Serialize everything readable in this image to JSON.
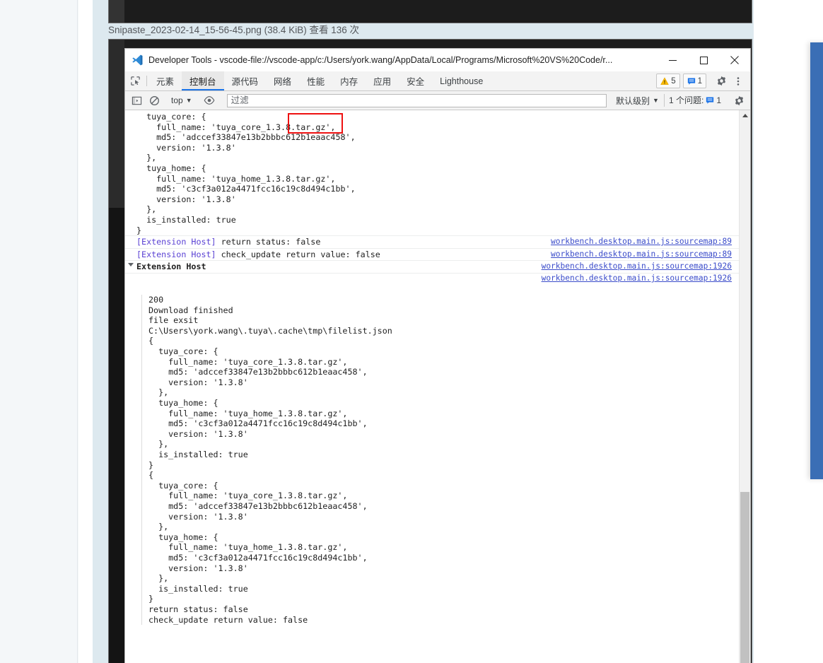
{
  "attachment": {
    "caption": "Snipaste_2023-02-14_15-56-45.png (38.4 KiB) 查看 136 次"
  },
  "devtools": {
    "window_title": "Developer Tools - vscode-file://vscode-app/c:/Users/york.wang/AppData/Local/Programs/Microsoft%20VS%20Code/r...",
    "window_controls": {
      "minimize": "minimize-icon",
      "maximize": "maximize-icon",
      "close": "close-icon"
    },
    "logo_icon": "vscode-logo-icon",
    "inspect_icon": "inspect-element-icon",
    "tabs": [
      {
        "label": "元素",
        "active": false
      },
      {
        "label": "控制台",
        "active": true
      },
      {
        "label": "源代码",
        "active": false
      },
      {
        "label": "网络",
        "active": false
      },
      {
        "label": "性能",
        "active": false
      },
      {
        "label": "内存",
        "active": false
      },
      {
        "label": "应用",
        "active": false
      },
      {
        "label": "安全",
        "active": false
      },
      {
        "label": "Lighthouse",
        "active": false
      }
    ],
    "badges": {
      "warning_icon": "warning-triangle-icon",
      "warning_count": "5",
      "info_icon": "info-message-icon",
      "info_count": "1"
    },
    "settings_icon": "gear-icon",
    "more_icon": "kebab-menu-icon",
    "accent_color": "#1a73e8",
    "annotation_color": "#ee1111"
  },
  "console_toolbar": {
    "sidebar_toggle_icon": "console-sidebar-toggle-icon",
    "clear_icon": "clear-console-icon",
    "context_label": "top",
    "context_caret": "▼",
    "eye_icon": "live-expression-eye-icon",
    "filter_placeholder": "过滤",
    "filter_value": "",
    "level_label": "默认级别",
    "level_caret": "▼",
    "issues_label": "1 个问题:",
    "issues_icon": "info-message-icon",
    "issues_count": "1",
    "settings_icon": "gear-icon"
  },
  "console": {
    "source_link_89": "workbench.desktop.main.js:sourcemap:89",
    "source_link_1926": "workbench.desktop.main.js:sourcemap:1926",
    "ext_prefix": "[Extension Host]",
    "top_fragment": [
      "  tuya_core: {",
      "    full_name: 'tuya_core_1.3.8.tar.gz',",
      "    md5: 'adccef33847e13b2bbbc612b1eaac458',",
      "    version: '1.3.8'",
      "  },",
      "  tuya_home: {",
      "    full_name: 'tuya_home_1.3.8.tar.gz',",
      "    md5: 'c3cf3a012a4471fcc16c19c8d494c1bb',",
      "    version: '1.3.8'",
      "  },",
      "  is_installed: true",
      "}"
    ],
    "msg_return_status": " return status: false",
    "msg_check_update": " check_update return value: false",
    "group_title": "Extension Host",
    "group_lines": [
      "200",
      "Download finished",
      "file exsit",
      "C:\\Users\\york.wang\\.tuya\\.cache\\tmp\\filelist.json",
      "{",
      "  tuya_core: {",
      "    full_name: 'tuya_core_1.3.8.tar.gz',",
      "    md5: 'adccef33847e13b2bbbc612b1eaac458',",
      "    version: '1.3.8'",
      "  },",
      "  tuya_home: {",
      "    full_name: 'tuya_home_1.3.8.tar.gz',",
      "    md5: 'c3cf3a012a4471fcc16c19c8d494c1bb',",
      "    version: '1.3.8'",
      "  },",
      "  is_installed: true",
      "}",
      "{",
      "  tuya_core: {",
      "    full_name: 'tuya_core_1.3.8.tar.gz',",
      "    md5: 'adccef33847e13b2bbbc612b1eaac458',",
      "    version: '1.3.8'",
      "  },",
      "  tuya_home: {",
      "    full_name: 'tuya_home_1.3.8.tar.gz',",
      "    md5: 'c3cf3a012a4471fcc16c19c8d494c1bb',",
      "    version: '1.3.8'",
      "  },",
      "  is_installed: true",
      "}",
      "return status: false",
      "check_update return value: false"
    ]
  }
}
